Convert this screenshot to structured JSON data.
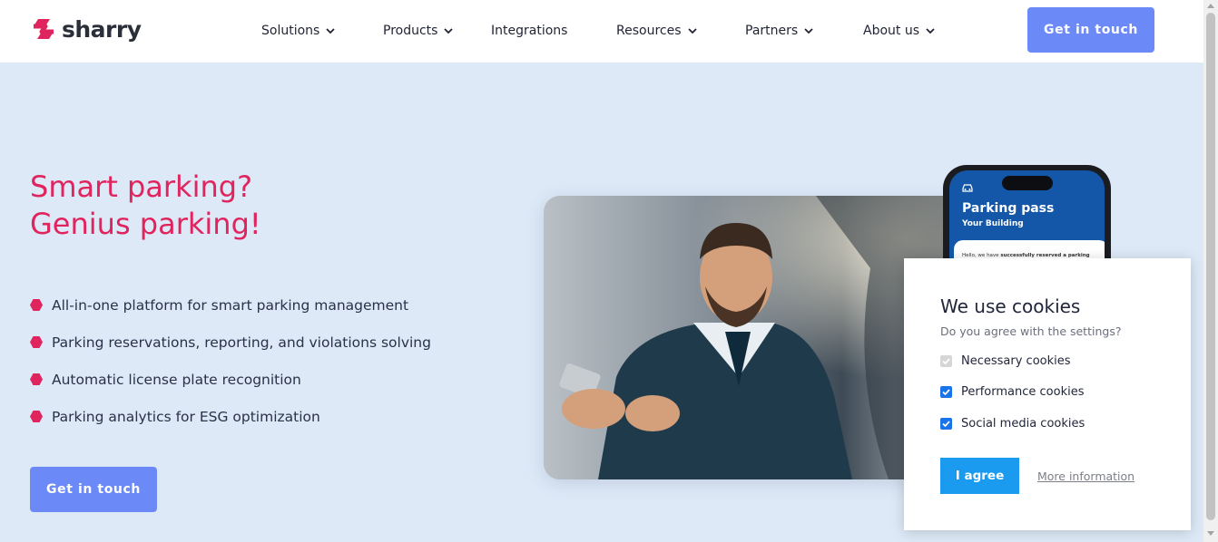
{
  "brand": {
    "name": "sharry",
    "accent_color": "#e0245e",
    "button_color": "#6b8af7",
    "background_color": "#dde9f7"
  },
  "nav": {
    "items": [
      {
        "label": "Solutions",
        "has_dropdown": true
      },
      {
        "label": "Products",
        "has_dropdown": true
      },
      {
        "label": "Integrations",
        "has_dropdown": false
      },
      {
        "label": "Resources",
        "has_dropdown": true
      },
      {
        "label": "Partners",
        "has_dropdown": true
      },
      {
        "label": "About us",
        "has_dropdown": true
      }
    ],
    "cta_label": "Get in touch"
  },
  "hero": {
    "headline_line1": "Smart parking?",
    "headline_line2": "Genius parking!",
    "features": [
      "All-in-one platform for smart parking management",
      "Parking reservations, reporting, and violations solving",
      "Automatic license plate recognition",
      "Parking analytics for ESG optimization"
    ],
    "cta_label": "Get in touch"
  },
  "phone": {
    "title": "Parking pass",
    "subtitle": "Your Building",
    "message_prefix": "Hello, we have ",
    "message_bold": "successfully reserved a parking"
  },
  "cookies": {
    "title": "We use cookies",
    "question": "Do you agree with the settings?",
    "options": [
      {
        "label": "Necessary cookies",
        "checked": true,
        "disabled": true
      },
      {
        "label": "Performance cookies",
        "checked": true,
        "disabled": false
      },
      {
        "label": "Social media cookies",
        "checked": true,
        "disabled": false
      }
    ],
    "agree_label": "I agree",
    "more_label": "More information"
  }
}
